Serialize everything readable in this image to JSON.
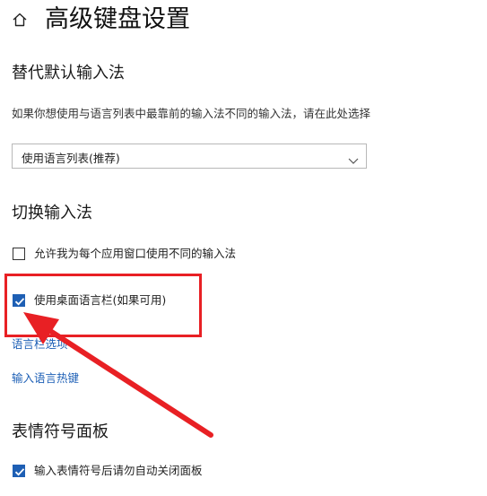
{
  "header": {
    "title": "高级键盘设置",
    "home_icon": "home-icon"
  },
  "override_input": {
    "title": "替代默认输入法",
    "description": "如果你想使用与语言列表中最靠前的输入法不同的输入法，请在此处选择",
    "select": {
      "value": "使用语言列表(推荐)",
      "icon": "chevron-down-icon"
    }
  },
  "switch_input": {
    "title": "切换输入法",
    "per_app_checkbox": {
      "label": "允许我为每个应用窗口使用不同的输入法",
      "checked": false
    },
    "desktop_bar_checkbox": {
      "label": "使用桌面语言栏(如果可用)",
      "checked": true
    },
    "language_bar_link": "语言栏选项",
    "hotkeys_link": "输入语言热键"
  },
  "emoji_panel": {
    "title": "表情符号面板",
    "auto_close_checkbox": {
      "label": "输入表情符号后请勿自动关闭面板",
      "checked": true
    }
  },
  "annotation": {
    "color": "#e82024"
  }
}
